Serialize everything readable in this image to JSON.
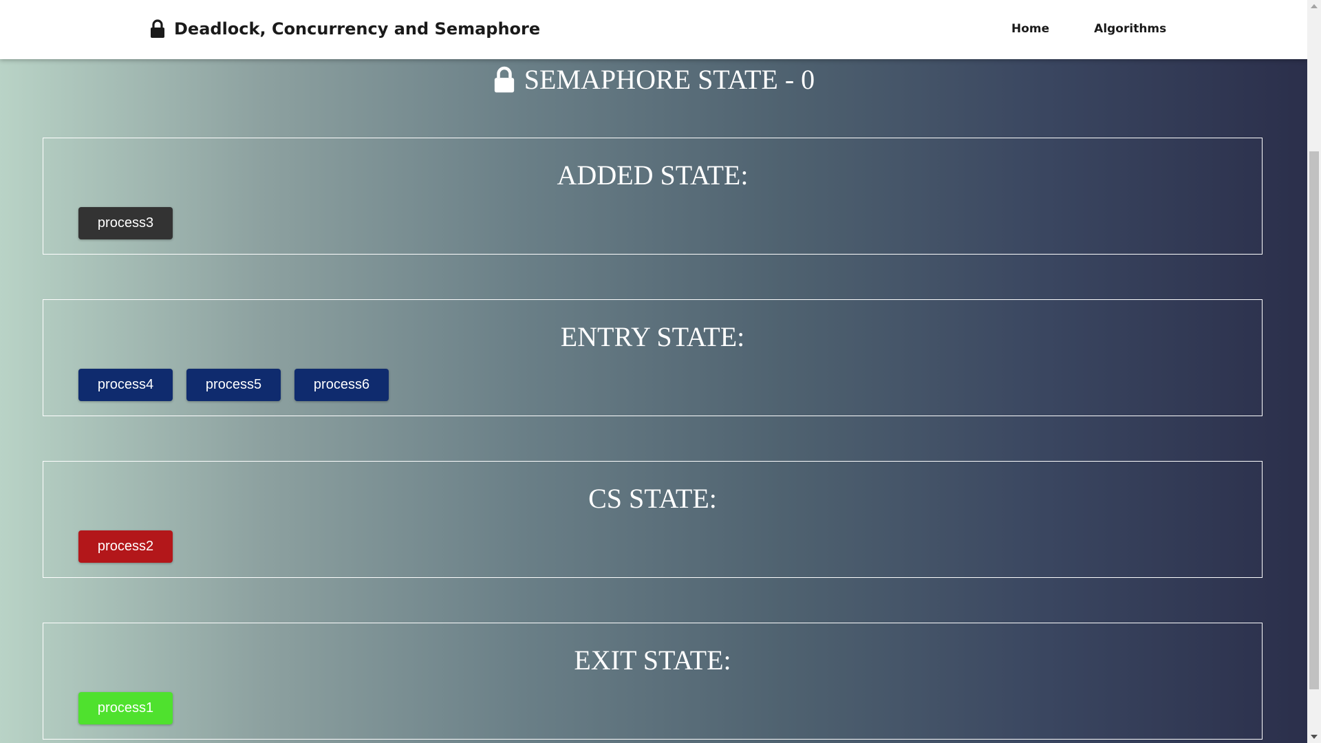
{
  "navbar": {
    "brand_icon": "lock-icon",
    "brand_title": "Deadlock, Concurrency and Semaphore",
    "links": [
      "Home",
      "Algorithms"
    ]
  },
  "semaphore": {
    "icon": "lock-icon",
    "title": "SEMAPHORE STATE - 0"
  },
  "states": [
    {
      "title": "ADDED STATE:",
      "color": "#333333",
      "processes": [
        "process3"
      ]
    },
    {
      "title": "ENTRY STATE:",
      "color": "#0f2b6e",
      "processes": [
        "process4",
        "process5",
        "process6"
      ]
    },
    {
      "title": "CS STATE:",
      "color": "#b3171a",
      "processes": [
        "process2"
      ]
    },
    {
      "title": "EXIT STATE:",
      "color": "#4fe12e",
      "processes": [
        "process1"
      ]
    }
  ]
}
